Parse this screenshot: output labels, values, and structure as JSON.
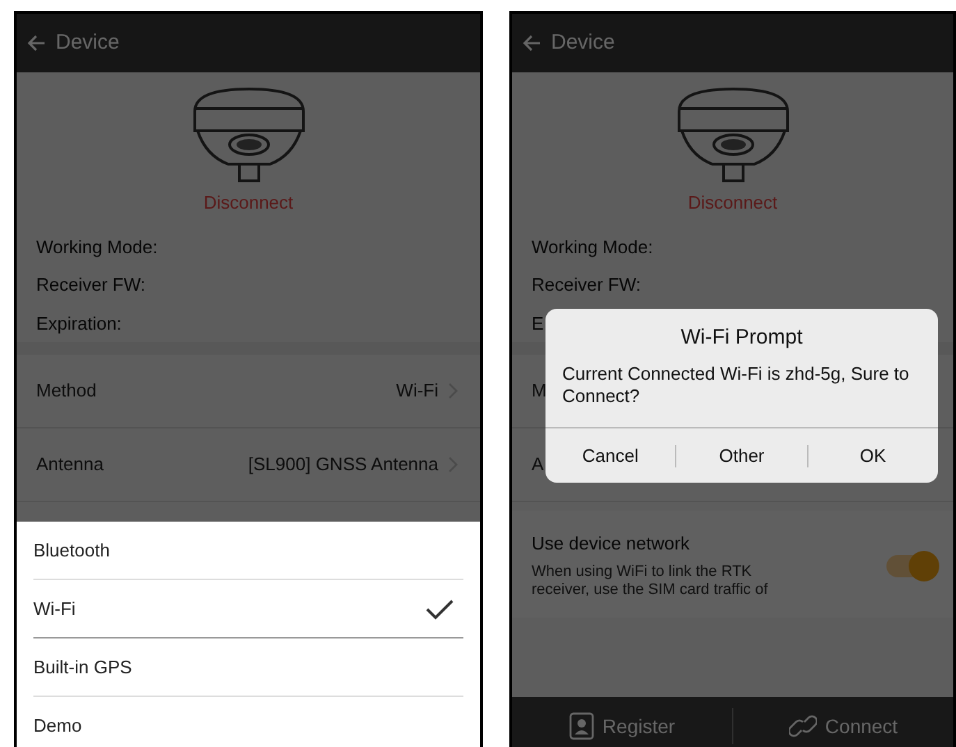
{
  "screens": [
    {
      "header": {
        "title": "Device"
      },
      "status": "Disconnect",
      "info": [
        "Working Mode:",
        "Receiver FW:",
        "Expiration:"
      ],
      "settings": [
        {
          "label": "Method",
          "value": "Wi-Fi"
        },
        {
          "label": "Antenna",
          "value": "[SL900] GNSS Antenna"
        }
      ],
      "sheet": {
        "options": [
          {
            "label": "Bluetooth",
            "selected": false
          },
          {
            "label": "Wi-Fi",
            "selected": true
          },
          {
            "label": "Built-in GPS",
            "selected": false
          },
          {
            "label": "Demo",
            "selected": false
          }
        ]
      }
    },
    {
      "header": {
        "title": "Device"
      },
      "status": "Disconnect",
      "info": [
        "Working Mode:",
        "Receiver FW:",
        "E"
      ],
      "settings": [
        {
          "label": "M"
        },
        {
          "label": "A"
        }
      ],
      "network": {
        "title": "Use device network",
        "description": "When using WiFi to link the RTK receiver, use the SIM card traffic of",
        "on": true
      },
      "footer": [
        {
          "label": "Register",
          "kind": "register"
        },
        {
          "label": "Connect",
          "kind": "connect"
        }
      ],
      "dialog": {
        "title": "Wi-Fi Prompt",
        "message": "Current Connected Wi-Fi is zhd-5g, Sure to Connect?",
        "buttons": [
          "Cancel",
          "Other",
          "OK"
        ]
      }
    }
  ]
}
